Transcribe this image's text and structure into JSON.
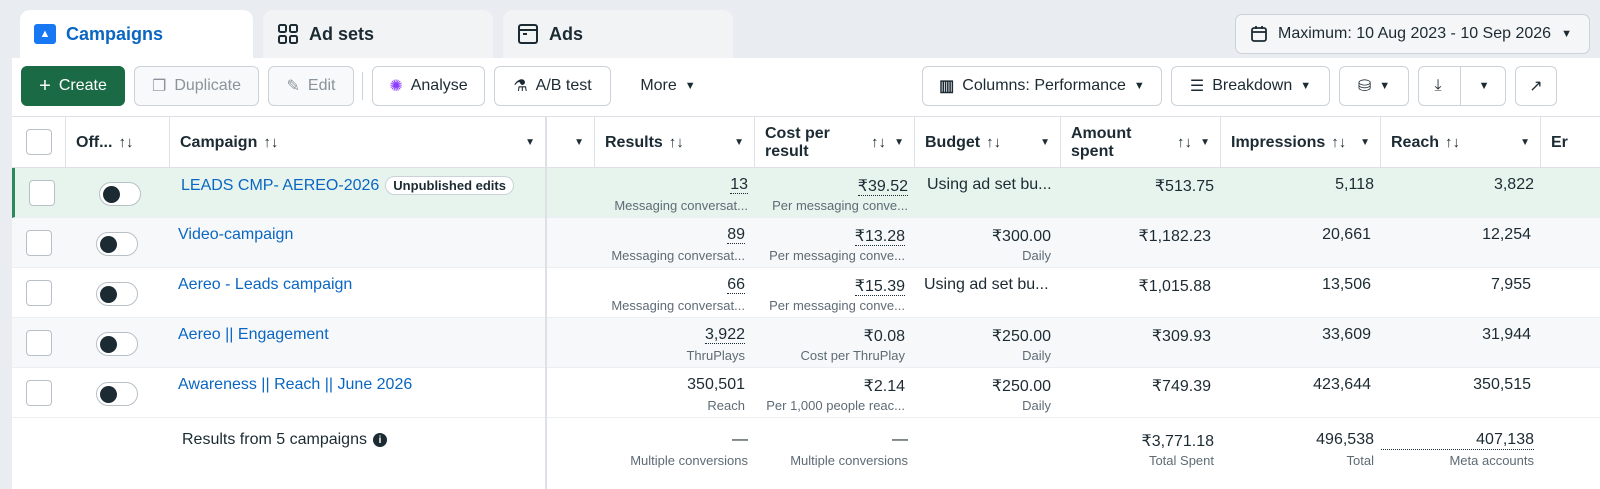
{
  "tabs": [
    {
      "label": "Campaigns",
      "icon": "campaign-folder-icon",
      "active": true
    },
    {
      "label": "Ad sets",
      "icon": "grid-icon",
      "active": false
    },
    {
      "label": "Ads",
      "icon": "ad-frame-icon",
      "active": false
    }
  ],
  "date_range": "Maximum: 10 Aug 2023 - 10 Sep 2026",
  "toolbar": {
    "create": "Create",
    "duplicate": "Duplicate",
    "edit": "Edit",
    "analyse": "Analyse",
    "ab_test": "A/B test",
    "more": "More",
    "columns": "Columns: Performance",
    "breakdown": "Breakdown"
  },
  "columns": {
    "off": "Off...",
    "campaign": "Campaign",
    "results": "Results",
    "cost_per_result_1": "Cost per",
    "cost_per_result_2": "result",
    "budget": "Budget",
    "amount_spent_1": "Amount",
    "amount_spent_2": "spent",
    "impressions": "Impressions",
    "reach": "Reach",
    "next": "Er"
  },
  "rows": [
    {
      "name": "LEADS CMP- AEREO-2026",
      "badge": "Unpublished edits",
      "results": "13",
      "results_sub": "Messaging conversat...",
      "cost": "₹39.52",
      "cost_sub": "Per messaging conve...",
      "budget": "Using ad set bu...",
      "budget_sub": "",
      "spent": "₹513.75",
      "impressions": "5,118",
      "reach": "3,822"
    },
    {
      "name": "Video-campaign",
      "badge": "",
      "results": "89",
      "results_sub": "Messaging conversat...",
      "cost": "₹13.28",
      "cost_sub": "Per messaging conve...",
      "budget": "₹300.00",
      "budget_sub": "Daily",
      "spent": "₹1,182.23",
      "impressions": "20,661",
      "reach": "12,254"
    },
    {
      "name": "Aereo - Leads campaign",
      "badge": "",
      "results": "66",
      "results_sub": "Messaging conversat...",
      "cost": "₹15.39",
      "cost_sub": "Per messaging conve...",
      "budget": "Using ad set bu...",
      "budget_sub": "",
      "spent": "₹1,015.88",
      "impressions": "13,506",
      "reach": "7,955"
    },
    {
      "name": "Aereo || Engagement",
      "badge": "",
      "results": "3,922",
      "results_sub": "ThruPlays",
      "cost": "₹0.08",
      "cost_sub": "Cost per ThruPlay",
      "budget": "₹250.00",
      "budget_sub": "Daily",
      "spent": "₹309.93",
      "impressions": "33,609",
      "reach": "31,944"
    },
    {
      "name": "Awareness || Reach || June 2026",
      "badge": "",
      "results": "350,501",
      "results_sub": "Reach",
      "cost": "₹2.14",
      "cost_sub": "Per 1,000 people reac...",
      "budget": "₹250.00",
      "budget_sub": "Daily",
      "spent": "₹749.39",
      "impressions": "423,644",
      "reach": "350,515"
    }
  ],
  "summary": {
    "label": "Results from 5 campaigns",
    "results": "—",
    "results_sub": "Multiple conversions",
    "cost": "—",
    "cost_sub": "Multiple conversions",
    "spent": "₹3,771.18",
    "spent_sub": "Total Spent",
    "impressions": "496,538",
    "impressions_sub": "Total",
    "reach": "407,138",
    "reach_sub": "Meta accounts"
  },
  "colors": {
    "primary_green": "#1a6b45",
    "link_blue": "#0a66c2",
    "highlight_row": "#e7f4ee"
  }
}
